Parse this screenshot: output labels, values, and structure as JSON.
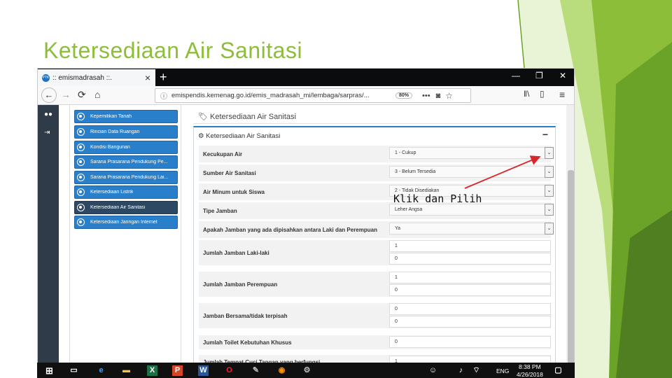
{
  "slide": {
    "title": "Ketersediaan Air Sanitasi",
    "colors": {
      "accent": "#8dbe3a",
      "accent_dark": "#4f7f21",
      "arrow": "#d9262a"
    }
  },
  "browser": {
    "tab_title": ":: emismadrasah ::.",
    "tab_close": "×",
    "new_tab": "+",
    "win_min": "—",
    "win_max": "❐",
    "win_close": "✕",
    "url": "emispendis.kemenag.go.id/emis_madrasah_mi/lembaga/sarpras/...",
    "url_badge": "80%",
    "toolbar_more": "•••",
    "icons": [
      "back-icon",
      "forward-icon",
      "reload-icon",
      "home-icon",
      "info-icon",
      "pocket-icon",
      "bookmark-star-icon",
      "library-icon",
      "sidebar-icon",
      "menu-icon"
    ]
  },
  "sidebar": {
    "items": [
      {
        "label": "Kepemilikan Tanah",
        "active": false
      },
      {
        "label": "Rincian Data Ruangan",
        "active": false
      },
      {
        "label": "Kondisi Bangunan",
        "active": false
      },
      {
        "label": "Sarana Prasarana Pendukung Pe...",
        "active": false
      },
      {
        "label": "Sarana Prasarana Pendukung Lai...",
        "active": false
      },
      {
        "label": "Ketersediaan Listrik",
        "active": false
      },
      {
        "label": "Ketersediaan Air Sanitasi",
        "active": true
      },
      {
        "label": "Ketersediaan Jaringan Internet",
        "active": false
      }
    ]
  },
  "main": {
    "page_heading": "Ketersediaan Air Sanitasi",
    "panel_title": "Ketersediaan Air Sanitasi",
    "panel_collapse": "−",
    "fields": [
      {
        "label": "Kecukupan Air",
        "value": "1 - Cukup",
        "dropdown": true
      },
      {
        "label": "Sumber Air Sanitasi",
        "value": "3 - Belum Tersedia",
        "dropdown": true
      },
      {
        "label": "Air Minum untuk Siswa",
        "value": "2 - Tidak Disediakan",
        "dropdown": true
      },
      {
        "label": "Tipe Jamban",
        "value": "Leher Angsa",
        "dropdown": true
      },
      {
        "label": "Apakah Jamban yang ada dipisahkan antara Laki dan Perempuan",
        "value": "Ya",
        "dropdown": true
      },
      {
        "label": "Jumlah Jamban Laki-laki",
        "values": [
          "1",
          "0"
        ]
      },
      {
        "label": "Jumlah Jamban Perempuan",
        "values": [
          "1",
          "0"
        ]
      },
      {
        "label": "Jamban Bersama/tidak terpisah",
        "values": [
          "0",
          "0"
        ]
      },
      {
        "label": "Jumlah Toilet Kebutuhan Khusus",
        "values": [
          "0"
        ]
      },
      {
        "label": "Jumlah Tempat Cuci Tangan yang berfungsi",
        "values": [
          "1"
        ]
      }
    ],
    "dropdown_glyph": "⌄"
  },
  "annotation": {
    "text": "Klik dan Pilih"
  },
  "taskbar": {
    "language": "ENG",
    "time": "8:38 PM",
    "date": "4/26/2018",
    "icons": [
      "windows-start-icon",
      "task-view-icon",
      "edge-icon",
      "file-explorer-icon",
      "excel-icon",
      "powerpoint-icon",
      "word-icon",
      "opera-icon",
      "paint-icon",
      "firefox-icon",
      "settings-app-icon",
      "people-icon",
      "volume-icon",
      "network-icon",
      "notification-icon"
    ]
  }
}
